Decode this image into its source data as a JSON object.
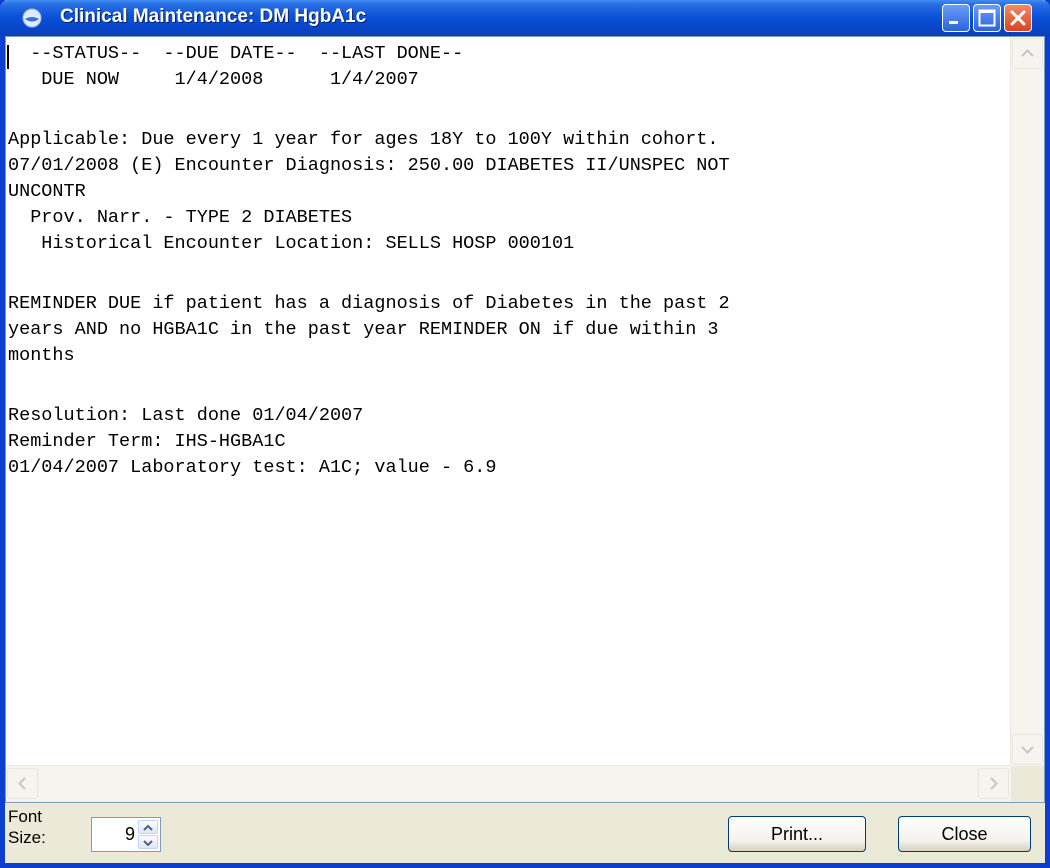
{
  "window": {
    "title": "Clinical Maintenance: DM HgbA1c",
    "icon": "reminder-globe-icon"
  },
  "titlebar_buttons": {
    "minimize": "minimize-icon",
    "maximize": "maximize-icon",
    "close": "close-icon"
  },
  "report": {
    "lines": [
      "  --STATUS--  --DUE DATE--  --LAST DONE--",
      "   DUE NOW     1/4/2008      1/4/2007",
      "",
      "Applicable: Due every 1 year for ages 18Y to 100Y within cohort.",
      "07/01/2008 (E) Encounter Diagnosis: 250.00 DIABETES II/UNSPEC NOT",
      "UNCONTR",
      "  Prov. Narr. - TYPE 2 DIABETES",
      "   Historical Encounter Location: SELLS HOSP 000101",
      "",
      "REMINDER DUE if patient has a diagnosis of Diabetes in the past 2",
      "years AND no HGBA1C in the past year REMINDER ON if due within 3",
      "months",
      "",
      "Resolution: Last done 01/04/2007",
      "Reminder Term: IHS-HGBA1C",
      "01/04/2007 Laboratory test: A1C; value - 6.9"
    ]
  },
  "footer": {
    "font_size_label_1": "Font",
    "font_size_label_2": "Size:",
    "font_size_value": "9",
    "print_label": "Print...",
    "close_label": "Close"
  },
  "colors": {
    "titlebar": "#0a52d8",
    "window_frame": "#0a3fd0",
    "dialog_face": "#ece9d8",
    "close_button": "#d8441c"
  }
}
